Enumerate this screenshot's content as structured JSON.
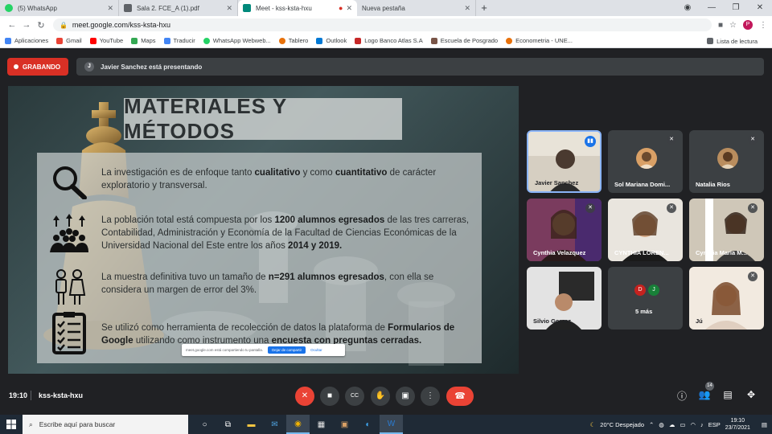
{
  "browser": {
    "tabs": [
      {
        "label": "(5) WhatsApp",
        "color": "#25d366",
        "active": false
      },
      {
        "label": "Sala 2. FCE_A (1).pdf",
        "color": "#5f6368",
        "active": false
      },
      {
        "label": "Meet - kss-ksta-hxu",
        "color": "#00897b",
        "active": true
      },
      {
        "label": "Nueva pestaña",
        "color": "#dadce0",
        "active": false
      }
    ],
    "url": "meet.google.com/kss-ksta-hxu",
    "profile_initial": "P",
    "bookmarks": [
      {
        "label": "Aplicaciones",
        "color": "#4285f4"
      },
      {
        "label": "Gmail",
        "color": "#ea4335"
      },
      {
        "label": "YouTube",
        "color": "#ff0000"
      },
      {
        "label": "Maps",
        "color": "#34a853"
      },
      {
        "label": "Traducir",
        "color": "#4285f4"
      },
      {
        "label": "WhatsApp Webweb...",
        "color": "#25d366"
      },
      {
        "label": "Tablero",
        "color": "#e8710a"
      },
      {
        "label": "Outlook",
        "color": "#0078d4"
      },
      {
        "label": "Logo Banco Atlas S.A",
        "color": "#c62828"
      },
      {
        "label": "Escuela de Posgrado",
        "color": "#795548"
      },
      {
        "label": "Econometria - UNE...",
        "color": "#e8710a"
      }
    ],
    "reading_list": "Lista de lectura"
  },
  "meet": {
    "recording_label": "GRABANDO",
    "presenter_initial": "J",
    "presenting_text": "Javier Sanchez está presentando",
    "slide": {
      "title": "MATERIALES Y MÉTODOS",
      "items": [
        {
          "pre": "La investigación es de enfoque tanto ",
          "b1": "cualitativo",
          "mid": " y como ",
          "b2": "cuantitativo",
          "post": " de carácter exploratorio y transversal."
        },
        {
          "pre": "La población total está compuesta por los ",
          "b1": "1200 alumnos egresados",
          "mid": " de las tres carreras, Contabilidad, Administración y Economía de la Facultad de Ciencias Económicas de la Universidad Nacional del Este entre los años ",
          "b2": "2014 y 2019.",
          "post": ""
        },
        {
          "pre": "La muestra definitiva tuvo un tamaño de ",
          "b1": "n=291 alumnos egresados",
          "mid": ", con ella se considera un margen de error del 3%.",
          "b2": "",
          "post": ""
        },
        {
          "pre": "Se utilizó como herramienta de recolección de datos la plataforma de ",
          "b1": "Formularios de Google",
          "mid": " utilizando como instrumento una ",
          "b2": "encuesta con preguntas cerradas.",
          "post": ""
        }
      ],
      "share_text": "meet.google.com está compartiendo tu pantalla.",
      "stop_label": "Dejar de compartir",
      "hide_label": "Ocultar"
    },
    "participants": [
      {
        "name": "Javier Sanchez"
      },
      {
        "name": "Sol Mariana Domi..."
      },
      {
        "name": "Natalia Rios"
      },
      {
        "name": "Cynthia Velazquez"
      },
      {
        "name": "CYNTHIA LOREN..."
      },
      {
        "name": "Cynthia Maria M..."
      },
      {
        "name": "Silvio Gomez"
      },
      {
        "name": "5 más"
      },
      {
        "name": "Jú"
      }
    ],
    "more_initials": [
      "D",
      "J"
    ],
    "time": "19:10",
    "meeting_code": "kss-ksta-hxu",
    "people_count": "14"
  },
  "taskbar": {
    "search_placeholder": "Escribe aquí para buscar",
    "weather": "20°C  Despejado",
    "lang": "ESP",
    "clock_time": "19:10",
    "clock_date": "23/7/2021"
  }
}
